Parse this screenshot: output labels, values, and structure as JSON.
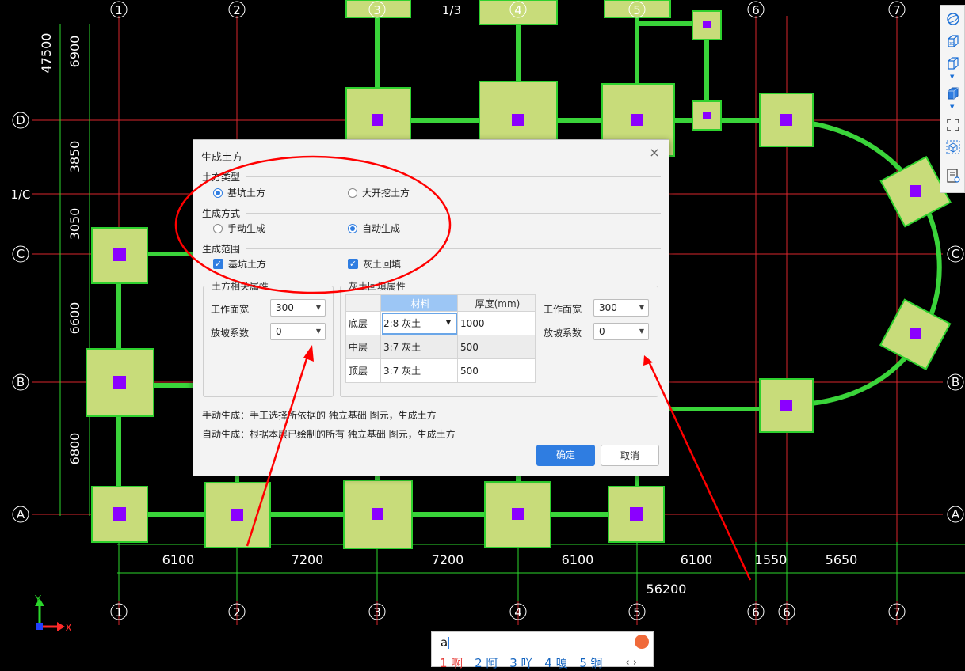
{
  "dialog": {
    "title": "生成土方",
    "close_glyph": "×",
    "section_type": {
      "label": "土方类型",
      "options": [
        {
          "label": "基坑土方",
          "selected": true
        },
        {
          "label": "大开挖土方",
          "selected": false
        }
      ]
    },
    "section_method": {
      "label": "生成方式",
      "options": [
        {
          "label": "手动生成",
          "selected": false
        },
        {
          "label": "自动生成",
          "selected": true
        }
      ]
    },
    "section_scope": {
      "label": "生成范围",
      "options": [
        {
          "label": "基坑土方",
          "checked": true
        },
        {
          "label": "灰土回填",
          "checked": true
        }
      ]
    },
    "earthwork_props": {
      "title": "土方相关属性",
      "fields": [
        {
          "label": "工作面宽",
          "value": "300"
        },
        {
          "label": "放坡系数",
          "value": "0"
        }
      ]
    },
    "backfill_props": {
      "title": "灰土回填属性",
      "columns": [
        "",
        "材料",
        "厚度(mm)"
      ],
      "rows": [
        {
          "layer": "底层",
          "material": "2:8 灰土",
          "thickness": "1000"
        },
        {
          "layer": "中层",
          "material": "3:7 灰土",
          "thickness": "500"
        },
        {
          "layer": "顶层",
          "material": "3:7 灰土",
          "thickness": "500"
        }
      ],
      "fields": [
        {
          "label": "工作面宽",
          "value": "300"
        },
        {
          "label": "放坡系数",
          "value": "0"
        }
      ]
    },
    "notes": [
      "手动生成：手工选择所依据的 独立基础 图元，生成土方",
      "自动生成：根据本层已绘制的所有 独立基础 图元，生成土方"
    ],
    "ok_label": "确定",
    "cancel_label": "取消"
  },
  "cad": {
    "grid_top_labels": [
      "1",
      "2",
      "3",
      "1/3",
      "4",
      "5",
      "6",
      "7"
    ],
    "grid_bottom_labels": [
      "1",
      "2",
      "3",
      "4",
      "5",
      "6",
      "6",
      "7"
    ],
    "grid_side_labels": [
      "D",
      "1/C",
      "C",
      "B",
      "A"
    ],
    "dims_bottom": [
      "6100",
      "7200",
      "7200",
      "6100",
      "6100",
      "1550",
      "5650"
    ],
    "dim_total": "56200",
    "dims_left": [
      "6900",
      "3850",
      "3050",
      "6600",
      "6800"
    ],
    "dim_left_total": "47500",
    "axis_y": "Y",
    "axis_x": "X",
    "colors": {
      "grid": "#d9262c",
      "beam": "#3ad43a",
      "footing": "#c8dc7a",
      "footing_border": "#2ed12e",
      "column": "#8b00ff",
      "annotation": "#ff0000"
    }
  },
  "toolbar": {
    "icons": [
      "sphere-icon",
      "view-3d-icon",
      "box-outline-icon",
      "dropdown-icon",
      "box-solid-icon",
      "dropdown-icon",
      "fullscreen-icon",
      "cube-select-icon",
      "properties-list-icon"
    ]
  },
  "ime": {
    "input": "a",
    "candidates": [
      "1 啊",
      "2 阿",
      "3 吖",
      "4 嗄",
      "5 锕"
    ],
    "nav": "‹ ›"
  }
}
